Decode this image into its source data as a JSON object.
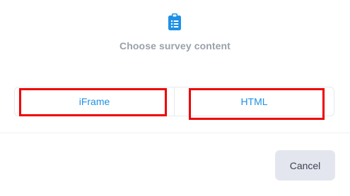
{
  "dialog": {
    "icon": "clipboard-list-icon",
    "title": "Choose survey content",
    "options": [
      {
        "label": "iFrame"
      },
      {
        "label": "HTML"
      }
    ],
    "cancel_label": "Cancel"
  },
  "colors": {
    "accent": "#1e90e6",
    "title": "#9aa0aa",
    "highlight": "#ee0000",
    "button_bg": "#e4e6ef"
  }
}
